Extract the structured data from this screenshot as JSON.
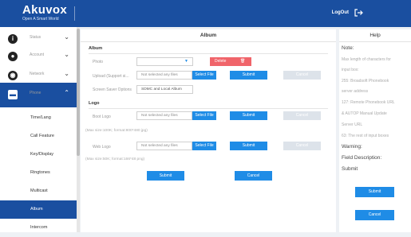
{
  "header": {
    "brand": "Akuvox",
    "tagline": "Open A Smart World",
    "logout_label": "LogOut",
    "logout_icon": "logout-icon"
  },
  "sidebar": {
    "items": [
      {
        "label": "Status",
        "icon": "info-icon"
      },
      {
        "label": "Account",
        "icon": "person-icon"
      },
      {
        "label": "Network",
        "icon": "globe-icon"
      },
      {
        "label": "Phone",
        "icon": "phone-icon"
      }
    ],
    "subitems": [
      "Time/Lang",
      "Call Feature",
      "Key/Display",
      "Ringtones",
      "Multicast",
      "Album",
      "Intercom"
    ],
    "active": "Album"
  },
  "main": {
    "title": "Album",
    "album_section": "Album",
    "photo_label": "Photo",
    "photo_select": "",
    "delete_label": "Delete",
    "upload_label": "Upload (Support si...",
    "upload_file_text": "Not selected any files",
    "select_file_label": "Select File",
    "submit_label": "Submit",
    "cancel_label": "Cancel",
    "screen_saver_label": "Screen Saver Options",
    "screen_saver_value": "SDMC and Local Album",
    "logo_section": "Logo",
    "boot_logo_label": "Boot Logo",
    "boot_logo_file": "Not selected any files",
    "boot_logo_note": "(Max size:100K; format:800*480 jpg)",
    "web_logo_label": "Web Logo",
    "web_logo_file": "Not selected any files",
    "web_logo_note": "(Max size:50K; format:166*48 png)",
    "footer_submit": "Submit",
    "footer_cancel": "Cancel"
  },
  "help": {
    "title": "Help",
    "note_head": "Note:",
    "lines": [
      "Max length of characters for",
      "input box:",
      "255: Broadsoft Phonebook",
      "server address",
      "127: Remote Phonebook URL",
      "& AUTOP Manual Update",
      "Server URL",
      "63: The rest of input boxes"
    ],
    "warning": "Warning:",
    "field_desc": "Field Description:",
    "submit_text": "Submit",
    "submit_btn": "Submit",
    "cancel_btn": "Cancel"
  }
}
